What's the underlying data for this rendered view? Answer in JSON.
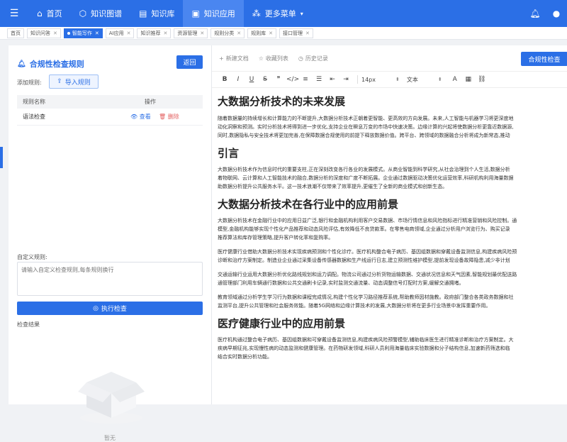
{
  "topnav": {
    "items": [
      {
        "label": "首页",
        "icon": "home-icon"
      },
      {
        "label": "知识图谱",
        "icon": "graph-icon"
      },
      {
        "label": "知识库",
        "icon": "library-icon"
      },
      {
        "label": "知识应用",
        "icon": "app-icon",
        "active": true
      },
      {
        "label": "更多菜单",
        "icon": "grid-icon"
      }
    ]
  },
  "tabs": [
    {
      "label": "首页"
    },
    {
      "label": "知识问答"
    },
    {
      "label": "智能写作",
      "active": true
    },
    {
      "label": "AI应用"
    },
    {
      "label": "知识推荐"
    },
    {
      "label": "资源管理"
    },
    {
      "label": "规则分类"
    },
    {
      "label": "规则库"
    },
    {
      "label": "接口管理"
    }
  ],
  "left": {
    "title": "合规性检查规则",
    "back_label": "返回",
    "add_label": "添加规则:",
    "import_label": "导入规则",
    "table": {
      "headers": [
        "规则名称",
        "操作"
      ],
      "rows": [
        {
          "name": "语法检查",
          "view": "查看",
          "delete": "删除"
        }
      ]
    },
    "custom_label": "自定义规则:",
    "custom_placeholder": "请输入自定义检查规则,每条规则换行",
    "exec_label": "执行检查",
    "result_label": "检查结果",
    "empty_text": "暂无"
  },
  "right": {
    "new_doc": "新建文档",
    "favorites": "收藏列表",
    "history": "历史记录",
    "check_label": "合规性检查",
    "font_size": "14px",
    "font_style": "文本"
  },
  "doc": {
    "title": "大数据分析技术的未来发展",
    "p1a": "随着数据量的持续增长和计算能力的不断提升,大数据分析技术正朝着更智能、更高效的方向发展。未来,人工智能与机器学习将更深度地",
    "p1b": "动化洞察和预测。实时分析技术将得到进一步优化,支持企业在瞬息万变的市场中快速决策。边缘计算的兴起将使数据分析更靠近数据源,",
    "p1c": "同时,数据隐私与安全技术将更加完善,在保障数据合规使用的前提下释放数据价值。跨平台、跨领域的数据融合分析将成为新常态,推动",
    "h_intro": "引言",
    "p2a": "大数据分析技术作为信息时代的重要支柱,正在深刻改变各行各业的发展模式。从商业智能到科学研究,从社会治理到个人生活,数据分析",
    "p2b": "着物联网、云计算和人工智能技术的融合,数据分析的深度和广度不断拓展。企业通过数据驱动决策优化运营效率,科研机构利用海量数据",
    "p2c": "助数据分析提升公共服务水平。这一技术浪潮不仅带来了效率提升,更催生了全新的商业模式和创新生态。",
    "h_industry": "大数据分析技术在各行业中的应用前景",
    "p3a": "大数据分析技术在金融行业中的应用日益广泛,银行和金融机构利用客户交易数据、市场行情信息和风险指标进行精准营销和风险控制。通",
    "p3b": "模型,金融机构能够实现个性化产品推荐和动态风险评估,有效降低不良贷款率。在零售电商领域,企业通过分析用户浏览行为、购买记录",
    "p3c": "推荐算法和库存管理策略,提升客户转化率和复购率。",
    "p4a": "医疗健康行业借助大数据分析技术实现疾病预测和个性化诊疗。医疗机构整合电子病历、基因组数据和穿戴设备监测信息,构建疾病风险预",
    "p4b": "诊断和治疗方案制定。制造业企业通过采集设备传感器数据和生产线运行日志,建立预测性维护模型,提前发现设备故障隐患,减少非计划",
    "p5a": "交通运输行业运用大数据分析优化路线规划和运力调配。物流公司通过分析货物运输数据、交通状况信息和天气因素,智能规划最优配送路",
    "p5b": "通管理部门利用车辆通行数据和公共交通刷卡记录,实时监测交通流量、动态调整信号灯配时方案,缓解交通拥堵。",
    "p6a": "教育领域通过分析学生学习行为数据和课程完成情况,构建个性化学习路径推荐系统,帮助教师因材施教。政府部门整合各类政务数据和社",
    "p6b": "监测平台,提升公共管理和社会服务效能。随着5G网络和边缘计算技术的发展,大数据分析将在更多行业场景中发挥重要作用。",
    "h_medical": "医疗健康行业中的应用前景",
    "p7a": "医疗机构通过整合电子病历、基因组数据和可穿戴设备监测信息,构建疾病风险预警模型,辅助临床医生进行精准诊断和治疗方案制定。大",
    "p7b": "疾病早期征兆,实现慢性病的动态监测和健康管理。在药物研发领域,科研人员利用海量临床实验数据和分子结构信息,加速新药筛选和临",
    "p7c": "结合实时数据分析功能。"
  }
}
